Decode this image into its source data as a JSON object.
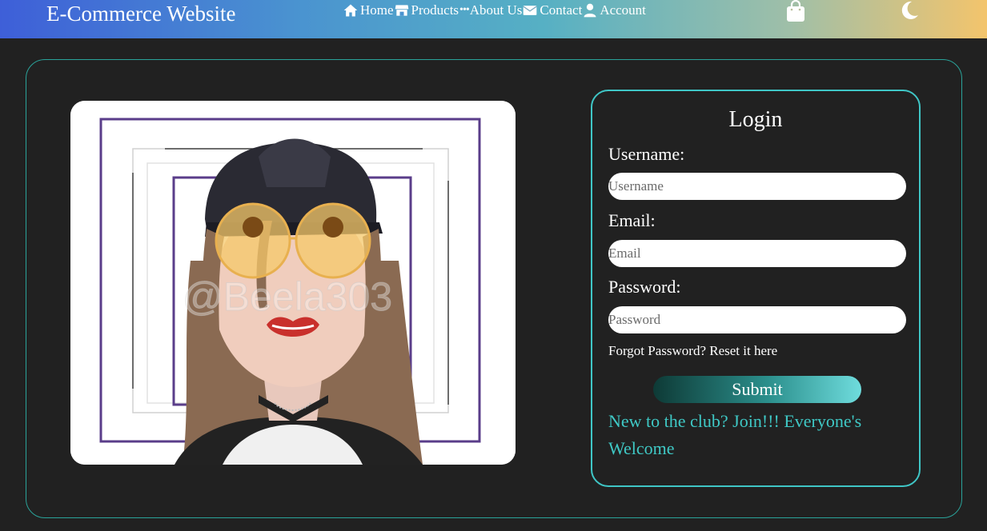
{
  "header": {
    "brand": "E-Commerce Website",
    "nav": [
      {
        "label": "Home",
        "icon": "home-icon"
      },
      {
        "label": "Products",
        "icon": "store-icon"
      },
      {
        "label": "About Us",
        "icon": "ellipsis-icon"
      },
      {
        "label": "Contact",
        "icon": "envelope-icon"
      },
      {
        "label": "Account",
        "icon": "user-icon"
      }
    ],
    "cart_icon": "shopping-bag-icon",
    "theme_icon": "moon-icon",
    "gradient": [
      "#3e5fd8",
      "#56b0c4",
      "#f3c46c"
    ]
  },
  "hero_image": {
    "watermark": "@Beela303"
  },
  "login": {
    "title": "Login",
    "username_label": "Username:",
    "username_placeholder": "Username",
    "email_label": "Email:",
    "email_placeholder": "Email",
    "password_label": "Password:",
    "password_placeholder": "Password",
    "forgot_text": "Forgot Password? Reset it here",
    "submit_label": "Submit",
    "join_text": "New to the club? Join!!! Everyone's Welcome",
    "accent": "#3fc6c6"
  }
}
